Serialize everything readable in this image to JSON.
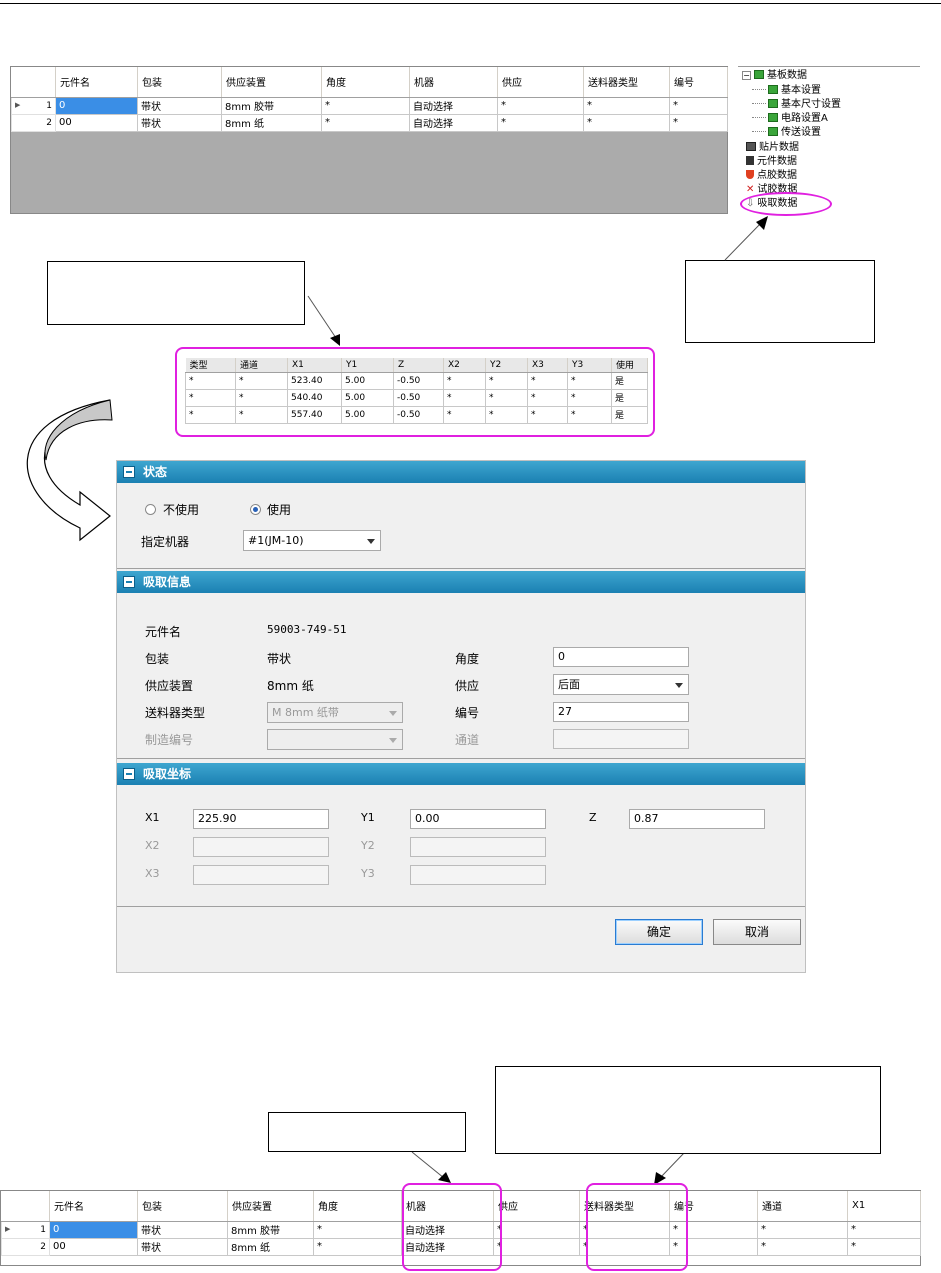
{
  "top_grid": {
    "headers": [
      "元件名",
      "包装",
      "供应装置",
      "角度",
      "机器",
      "供应",
      "送料器类型",
      "编号"
    ],
    "rows": [
      {
        "num": "1",
        "cells": [
          "0",
          "带状",
          "8mm 胶带",
          "*",
          "自动选择",
          "*",
          "*",
          "*"
        ]
      },
      {
        "num": "2",
        "cells": [
          "00",
          "带状",
          "8mm 纸",
          "*",
          "自动选择",
          "*",
          "*",
          "*"
        ]
      }
    ]
  },
  "tree": {
    "root": "基板数据",
    "children": [
      "基本设置",
      "基本尺寸设置",
      "电路设置A",
      "传送设置"
    ],
    "items": [
      "贴片数据",
      "元件数据",
      "点胶数据",
      "试胶数据",
      "吸取数据"
    ]
  },
  "mid_grid": {
    "headers": [
      "类型",
      "通道",
      "X1",
      "Y1",
      "Z",
      "X2",
      "Y2",
      "X3",
      "Y3",
      "使用"
    ],
    "rows": [
      [
        "*",
        "*",
        "523.40",
        "5.00",
        "-0.50",
        "*",
        "*",
        "*",
        "*",
        "是"
      ],
      [
        "*",
        "*",
        "540.40",
        "5.00",
        "-0.50",
        "*",
        "*",
        "*",
        "*",
        "是"
      ],
      [
        "*",
        "*",
        "557.40",
        "5.00",
        "-0.50",
        "*",
        "*",
        "*",
        "*",
        "是"
      ]
    ]
  },
  "dialog": {
    "status": {
      "title": "状态",
      "opt_unused": "不使用",
      "opt_used": "使用",
      "machine_label": "指定机器",
      "machine_value": "#1(JM-10)"
    },
    "pick_info": {
      "title": "吸取信息",
      "part_label": "元件名",
      "part_value": "59003-749-51",
      "pack_label": "包装",
      "pack_value": "带状",
      "feeder_label": "供应装置",
      "feeder_value": "8mm 纸",
      "ftype_label": "送料器类型",
      "ftype_value": "M 8mm 纸带",
      "mfg_label": "制造编号",
      "angle_label": "角度",
      "angle_value": "0",
      "supply_label": "供应",
      "supply_value": "后面",
      "no_label": "编号",
      "no_value": "27",
      "channel_label": "通道"
    },
    "coords": {
      "title": "吸取坐标",
      "x1_label": "X1",
      "x1_value": "225.90",
      "y1_label": "Y1",
      "y1_value": "0.00",
      "z_label": "Z",
      "z_value": "0.87",
      "x2_label": "X2",
      "y2_label": "Y2",
      "x3_label": "X3",
      "y3_label": "Y3"
    },
    "ok_label": "确定",
    "cancel_label": "取消"
  },
  "bottom_grid": {
    "headers": [
      "元件名",
      "包装",
      "供应装置",
      "角度",
      "机器",
      "供应",
      "送料器类型",
      "编号",
      "通道",
      "X1"
    ],
    "rows": [
      {
        "num": "1",
        "cells": [
          "0",
          "带状",
          "8mm 胶带",
          "*",
          "自动选择",
          "*",
          "*",
          "*",
          "*",
          "*"
        ]
      },
      {
        "num": "2",
        "cells": [
          "00",
          "带状",
          "8mm 纸",
          "*",
          "自动选择",
          "*",
          "*",
          "*",
          "*",
          "*"
        ]
      }
    ]
  },
  "colors": {
    "highlight": "#e020e0",
    "section_header": "#1b80b2",
    "selected_cell": "#3a8ee6"
  }
}
